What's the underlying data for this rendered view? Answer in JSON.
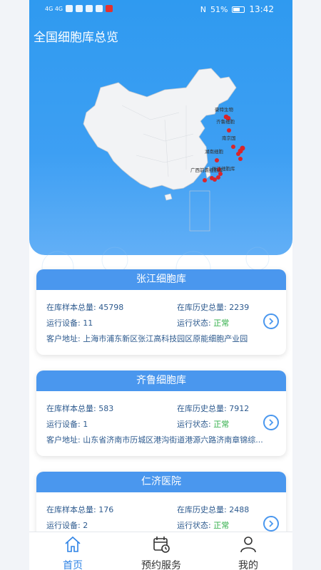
{
  "status_bar": {
    "net_text": "4G 4G",
    "battery": "51%",
    "time": "13:42"
  },
  "header": {
    "title": "全国细胞库总览"
  },
  "map": {
    "labels": [
      "豪特生物",
      "齐鲁细胞",
      "南京国",
      "湖南细胞",
      "广西前瞻细胞库",
      "张江细胞库"
    ]
  },
  "cards": [
    {
      "title": "张江细胞库",
      "stock_label": "在库样本总量:",
      "stock_value": "45798",
      "history_label": "在库历史总量:",
      "history_value": "2239",
      "device_label": "运行设备:",
      "device_value": "11",
      "state_label": "运行状态:",
      "state_value": "正常",
      "address_label": "客户地址:",
      "address_value": "上海市浦东新区张江高科技园区原能细胞产业园"
    },
    {
      "title": "齐鲁细胞库",
      "stock_label": "在库样本总量:",
      "stock_value": "583",
      "history_label": "在库历史总量:",
      "history_value": "7912",
      "device_label": "运行设备:",
      "device_value": "1",
      "state_label": "运行状态:",
      "state_value": "正常",
      "address_label": "客户地址:",
      "address_value": "山东省济南市历城区港沟街道港源六路济南章锦综..."
    },
    {
      "title": "仁济医院",
      "stock_label": "在库样本总量:",
      "stock_value": "176",
      "history_label": "在库历史总量:",
      "history_value": "2488",
      "device_label": "运行设备:",
      "device_value": "2",
      "state_label": "运行状态:",
      "state_value": "正常"
    }
  ],
  "tabbar": {
    "home": "首页",
    "booking": "预约服务",
    "mine": "我的"
  },
  "colors": {
    "primary": "#4a97ee",
    "ok": "#2fae47",
    "marker": "#d9252b"
  }
}
